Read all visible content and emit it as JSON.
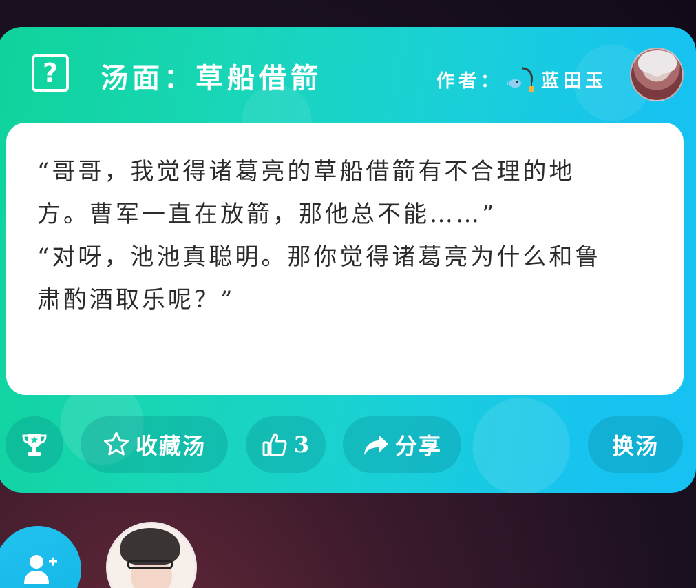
{
  "header": {
    "title": "汤面：草船借箭",
    "author_label": "作者：",
    "author_name": "蓝田玉"
  },
  "story": {
    "paragraphs": [
      "“哥哥，我觉得诸葛亮的草船借箭有不合理的地方。曹军一直在放箭，那他总不能……”",
      "“对呀，池池真聪明。那你觉得诸葛亮为什么和鲁肃酌酒取乐呢？”"
    ]
  },
  "actions": {
    "favorite_label": "收藏汤",
    "like_count": "3",
    "share_label": "分享",
    "change_label": "换汤"
  },
  "icons": {
    "help": "help-icon",
    "trophy": "trophy-icon",
    "star": "star-icon",
    "thumbs_up": "thumbs-up-icon",
    "share": "share-arrow-icon",
    "add_user": "add-user-icon"
  },
  "colors": {
    "card_gradient_start": "#0fd39a",
    "card_gradient_end": "#15c2f2",
    "button_bg": "rgba(0,110,120,0.22)",
    "text_white": "#ffffff",
    "story_text": "#2b2b2b"
  }
}
